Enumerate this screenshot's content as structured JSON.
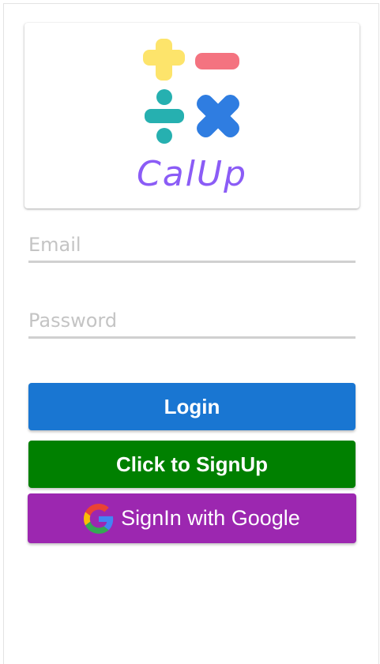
{
  "brand": {
    "name": "CalUp",
    "colors": {
      "plus": "#fde46b",
      "minus": "#f47380",
      "divide": "#26b0b0",
      "times": "#2f7de1",
      "text": "#8b5cf6"
    },
    "icons": [
      "plus-icon",
      "minus-icon",
      "divide-icon",
      "times-icon"
    ]
  },
  "form": {
    "email": {
      "placeholder": "Email",
      "value": ""
    },
    "password": {
      "placeholder": "Password",
      "value": ""
    }
  },
  "buttons": {
    "login": {
      "label": "Login",
      "color": "#1976d2"
    },
    "signup": {
      "label": "Click to SignUp",
      "color": "#008000"
    },
    "google": {
      "label": "SignIn with Google",
      "color": "#9c27b0",
      "icon": "google-icon"
    }
  }
}
